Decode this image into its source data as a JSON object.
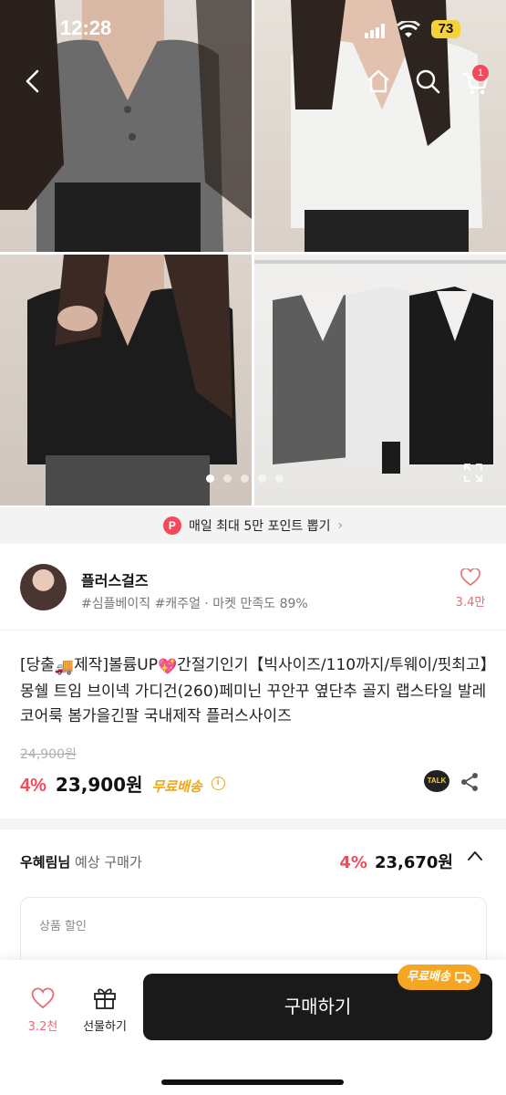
{
  "status_bar": {
    "time": "12:28",
    "battery": "73"
  },
  "nav": {
    "cart_badge": "1"
  },
  "gallery": {
    "slides_total": 5,
    "active_slide": 1
  },
  "point_banner": {
    "badge": "P",
    "text": "매일 최대 5만 포인트 뽑기",
    "chevron": "›"
  },
  "seller": {
    "name": "플러스걸즈",
    "tags": "#심플베이직 #캐주얼 · 마켓 만족도 89%",
    "likes": "3.4만"
  },
  "product": {
    "title_part1": "[당출",
    "title_emoji1": "🚚",
    "title_part2": "제작]볼륨UP",
    "title_emoji2": "💖",
    "title_part3": "간절기인기【빅사이즈/110까지/투웨이/핏최고】몽쉘 트임 브이넥 가디건(260)페미닌 꾸안꾸 옆단추 골지 랩스타일 발레코어룩 봄가을긴팔 국내제작 플러스사이즈",
    "original_price": "24,900원",
    "discount_rate": "4%",
    "price": "23,900원",
    "free_shipping": "무료배송",
    "info": "i",
    "talk_label": "TALK"
  },
  "expected_price": {
    "user": "우혜림님",
    "label": " 예상 구매가",
    "discount_rate": "4%",
    "price": "23,670원"
  },
  "discount_box": {
    "label": "상품 할인"
  },
  "bottom_bar": {
    "wish_count": "3.2천",
    "gift_label": "선물하기",
    "buy_label": "구매하기",
    "ship_tag": "무료배송"
  },
  "colors": {
    "accent": "#f04a5b",
    "shipping": "#f2a516",
    "button": "#1a1a1a"
  },
  "icons": [
    "back-icon",
    "home-icon",
    "search-icon",
    "cart-icon",
    "expand-icon",
    "heart-icon",
    "share-icon",
    "gift-icon",
    "chevron-up-icon",
    "truck-icon"
  ]
}
